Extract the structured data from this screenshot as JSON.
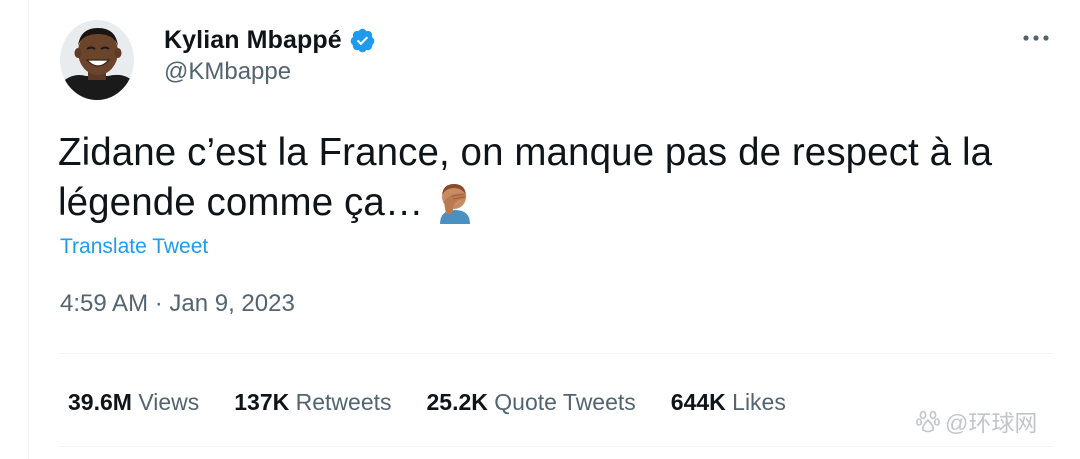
{
  "tweet": {
    "author": {
      "display_name": "Kylian Mbappé",
      "handle": "@KMbappe",
      "verified": true,
      "avatar_icon": "avatar-photo"
    },
    "more_icon": "more-horizontal-icon",
    "text_main": "Zidane c’est la France, on manque pas de respect à la légende comme ça…",
    "text_emoji": "man-facepalming-emoji",
    "translate_label": "Translate Tweet",
    "timestamp": "4:59 AM · Jan 9, 2023",
    "stats": [
      {
        "count": "39.6M",
        "label": "Views"
      },
      {
        "count": "137K",
        "label": "Retweets"
      },
      {
        "count": "25.2K",
        "label": "Quote Tweets"
      },
      {
        "count": "644K",
        "label": "Likes"
      }
    ]
  },
  "watermark": {
    "text": "@环球网"
  },
  "colors": {
    "accent": "#1d9bf0",
    "text_primary": "#0f1419",
    "text_secondary": "#536471",
    "divider": "#eff3f4"
  }
}
